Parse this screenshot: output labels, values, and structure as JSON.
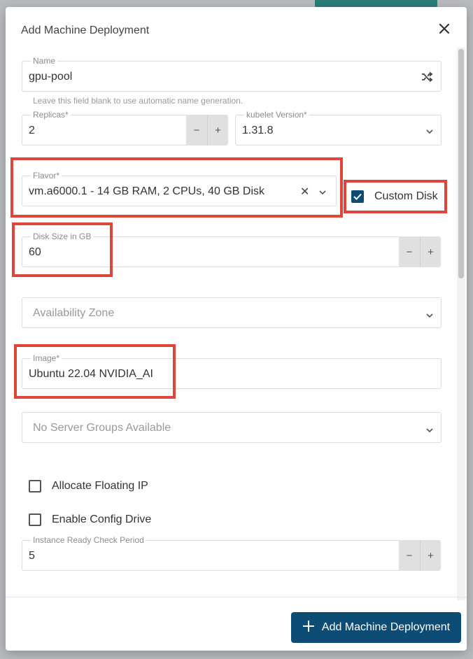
{
  "dialog": {
    "title": "Add Machine Deployment",
    "close_icon": "close-icon"
  },
  "name_field": {
    "label": "Name",
    "value": "gpu-pool",
    "hint": "Leave this field blank to use automatic name generation.",
    "icon": "shuffle-icon"
  },
  "replicas_field": {
    "label": "Replicas*",
    "value": "2",
    "decrement": "−",
    "increment": "+"
  },
  "kubelet_field": {
    "label": "kubelet Version*",
    "value": "1.31.8",
    "icon": "chevron-down-icon"
  },
  "flavor_field": {
    "label": "Flavor*",
    "value": "vm.a6000.1 - 14 GB RAM, 2 CPUs, 40 GB Disk",
    "clear": "✕",
    "icon": "chevron-down-icon"
  },
  "custom_disk": {
    "label": "Custom Disk",
    "checked": true
  },
  "disk_size_field": {
    "label": "Disk Size in GB",
    "value": "60",
    "decrement": "−",
    "increment": "+"
  },
  "availability_zone": {
    "placeholder": "Availability Zone",
    "icon": "chevron-down-icon"
  },
  "image_field": {
    "label": "Image*",
    "value": "Ubuntu 22.04 NVIDIA_AI"
  },
  "server_groups": {
    "placeholder": "No Server Groups Available",
    "icon": "chevron-down-icon"
  },
  "allocate_floating_ip": {
    "label": "Allocate Floating IP",
    "checked": false
  },
  "enable_config_drive": {
    "label": "Enable Config Drive",
    "checked": false
  },
  "instance_ready_check": {
    "label": "Instance Ready Check Period",
    "value": "5",
    "decrement": "−",
    "increment": "+"
  },
  "footer": {
    "submit_label": "Add Machine Deployment",
    "submit_icon": "plus-icon"
  },
  "colors": {
    "primary": "#0d4c74",
    "highlight": "#e0453b",
    "background_accent": "#2b7d7a"
  }
}
